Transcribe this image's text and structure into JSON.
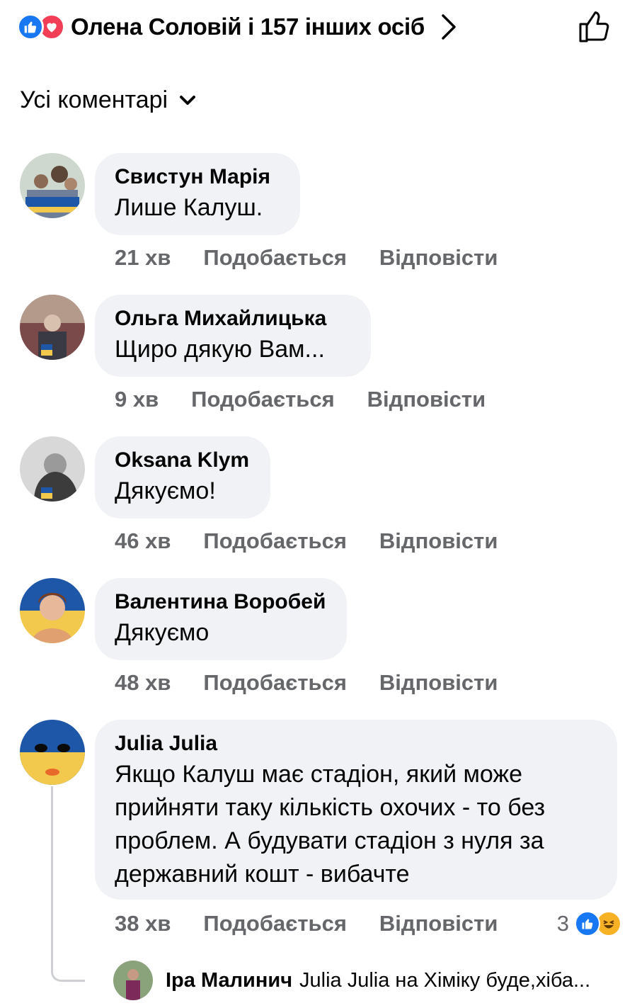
{
  "reactions": {
    "summary": "Олена Соловій і 157 інших осіб",
    "icons": [
      "like-icon",
      "love-icon"
    ]
  },
  "filter": {
    "label": "Усі коментарі"
  },
  "comments": [
    {
      "author": "Свистун Марія",
      "lines": [
        "Лише Калуш."
      ],
      "time": "21 хв",
      "like": "Подобається",
      "reply": "Відповісти"
    },
    {
      "author": "Ольга Михайлицька",
      "lines": [
        "Щиро дякую Вам..."
      ],
      "time": "9 хв",
      "like": "Подобається",
      "reply": "Відповісти"
    },
    {
      "author": "Oksana Klym",
      "lines": [
        "Дякуємо!"
      ],
      "time": "46 хв",
      "like": "Подобається",
      "reply": "Відповісти"
    },
    {
      "author": "Валентина Воробей",
      "lines": [
        "Дякуємо"
      ],
      "time": "48 хв",
      "like": "Подобається",
      "reply": "Відповісти"
    },
    {
      "author": "Julia Julia",
      "lines": [
        "Якщо Калуш має стадіон, який може",
        "прийняти таку кількість охочих - то без",
        "проблем. А будувати стадіон з нуля за",
        "державний кошт - вибачте"
      ],
      "time": "38 хв",
      "like": "Подобається",
      "reply": "Відповісти",
      "reaction_count": "3",
      "reaction_icons": [
        "like-icon",
        "haha-icon"
      ]
    }
  ],
  "reply_preview": {
    "author": "Іра Малинич",
    "text": "Julia Julia на Хіміку буде,хіба..."
  },
  "colors": {
    "facebook_blue": "#1877f2",
    "love_red": "#f33e58",
    "bubble_gray": "#f0f2f5",
    "meta_gray": "#65676b"
  }
}
